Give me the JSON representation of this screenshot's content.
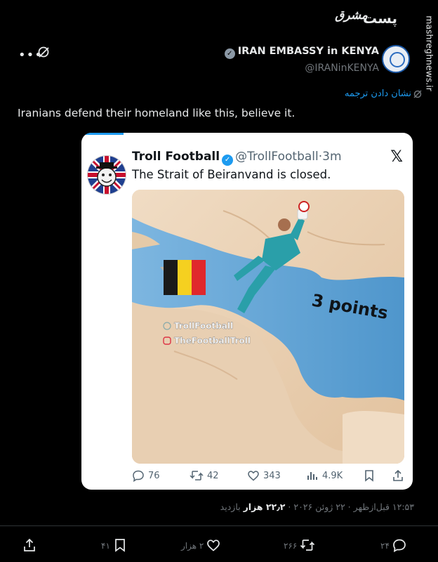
{
  "header": {
    "title": "پست",
    "brand_logo_text": "مشرق",
    "watermark": "mashreghnews.ir"
  },
  "post": {
    "author_name": "IRAN EMBASSY in KENYA",
    "author_handle": "@IRANinKENYA",
    "more_icon": "more-icon",
    "translate_label": "نشان دادن ترجمه",
    "text": "Iranians defend their homeland like this, believe it.",
    "timestamp": "۱۲:۵۳ قبل‌ازظهر · ۲۲ ژوئن ۲۰۲۶ ·",
    "views_count": "۲۲٫۲ هزار",
    "views_label": "بازدید"
  },
  "quoted": {
    "name": "Troll Football",
    "handle": "@TrollFootball",
    "time": "3m",
    "text": "The Strait of Beiranvand is closed.",
    "media": {
      "overlay_text": "3 points",
      "watermark_1": "TrollFootball",
      "watermark_2": "TheFootballTroll",
      "flag_colors": [
        "#1a1a1a",
        "#f5d020",
        "#e0282c"
      ],
      "sea_color": "#5ea3d6"
    },
    "replies": "76",
    "retweets": "42",
    "likes": "343",
    "views": "4.9K"
  },
  "actions": {
    "replies": "۲۴",
    "retweets": "۲۶۶",
    "likes": "۲ هزار",
    "bookmarks": "۴۱"
  },
  "colors": {
    "background": "#000000",
    "accent": "#1d9bf0",
    "muted": "#71767b"
  }
}
